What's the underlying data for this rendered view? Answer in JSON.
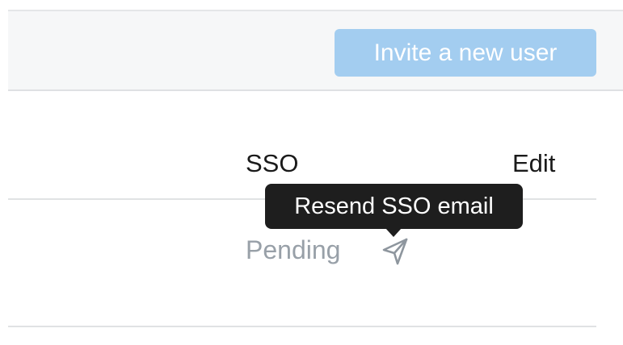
{
  "toolbar": {
    "invite_button_label": "Invite a new user"
  },
  "table": {
    "columns": {
      "sso": "SSO",
      "edit": "Edit"
    },
    "rows": [
      {
        "sso_status": "Pending",
        "resend_icon": "paper-plane-icon"
      }
    ]
  },
  "tooltip": {
    "text": "Resend SSO email"
  },
  "colors": {
    "button_background": "#a3cdf0",
    "toolbar_background": "#f6f7f8",
    "tooltip_background": "#1e1e1e",
    "pending_text": "#98a0a8",
    "icon": "#8e969e"
  }
}
